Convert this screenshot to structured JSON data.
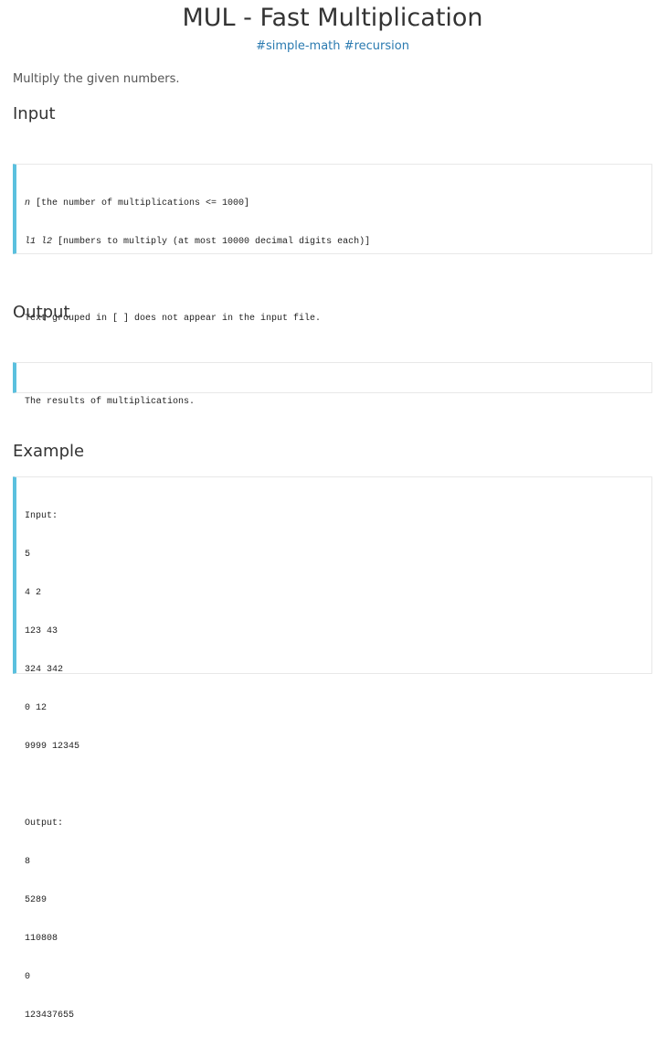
{
  "problem": {
    "title": "MUL - Fast Multiplication",
    "tags": [
      "#simple-math",
      "#recursion"
    ],
    "statement": "Multiply the given numbers."
  },
  "input_section": {
    "heading": "Input",
    "line1_var": "n",
    "line1_text": " [the number of multiplications <= 1000]",
    "line2_var": "l1 l2",
    "line2_text": " [numbers to multiply (at most 10000 decimal digits each)]",
    "note": "Text grouped in [ ] does not appear in the input file."
  },
  "output_section": {
    "heading": "Output",
    "text": "The results of multiplications."
  },
  "example_section": {
    "heading": "Example",
    "lines": [
      "Input:",
      "5",
      "4 2",
      "123 43",
      "324 342",
      "0 12",
      "9999 12345",
      "",
      "Output:",
      "8",
      "5289",
      "110808",
      "0",
      "123437655"
    ]
  },
  "colors": {
    "accent_border": "#5bc0de",
    "tag_link": "#2a7ab0",
    "text": "#333333"
  }
}
